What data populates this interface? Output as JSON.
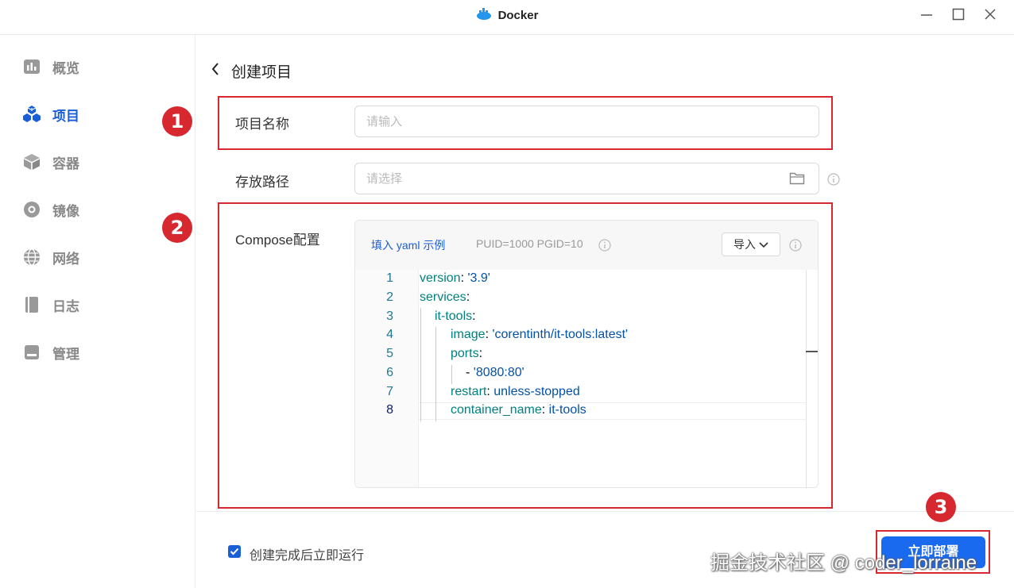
{
  "window": {
    "title": "Docker"
  },
  "sidebar": {
    "items": [
      {
        "label": "概览",
        "icon": "chart-icon"
      },
      {
        "label": "项目",
        "icon": "cubes-icon",
        "active": true
      },
      {
        "label": "容器",
        "icon": "container-box-icon"
      },
      {
        "label": "镜像",
        "icon": "disc-icon"
      },
      {
        "label": "网络",
        "icon": "globe-icon"
      },
      {
        "label": "日志",
        "icon": "book-icon"
      },
      {
        "label": "管理",
        "icon": "manage-icon"
      }
    ]
  },
  "page": {
    "title": "创建项目"
  },
  "form": {
    "name_label": "项目名称",
    "name_placeholder": "请输入",
    "path_label": "存放路径",
    "path_placeholder": "请选择",
    "compose_label": "Compose配置"
  },
  "editor": {
    "example_link": "填入 yaml 示例",
    "env_hint": "PUID=1000 PGID=10",
    "import_label": "导入",
    "line_numbers": [
      "1",
      "2",
      "3",
      "4",
      "5",
      "6",
      "7",
      "8"
    ],
    "lines": [
      {
        "key": "version",
        "sep": ": ",
        "value": "'3.9'"
      },
      {
        "key": "services",
        "sep": ":",
        "value": ""
      },
      {
        "key": "it-tools",
        "sep": ":",
        "value": ""
      },
      {
        "key": "image",
        "sep": ": ",
        "value": "'corentinth/it-tools:latest'"
      },
      {
        "key": "ports",
        "sep": ":",
        "value": ""
      },
      {
        "key": "- ",
        "sep": "",
        "value": "'8080:80'"
      },
      {
        "key": "restart",
        "sep": ": ",
        "value": "unless-stopped"
      },
      {
        "key": "container_name",
        "sep": ": ",
        "value": "it-tools"
      }
    ]
  },
  "footer": {
    "run_after_create_label": "创建完成后立即运行",
    "run_after_create_checked": true,
    "deploy_label": "立即部署"
  },
  "annotations": {
    "badges": [
      "1",
      "2",
      "3"
    ],
    "color": "#d7282f"
  },
  "watermark": "掘金技术社区 @ coder_lorraine",
  "colors": {
    "accent": "#1a5fd6",
    "deploy_button": "#1a6af0"
  }
}
